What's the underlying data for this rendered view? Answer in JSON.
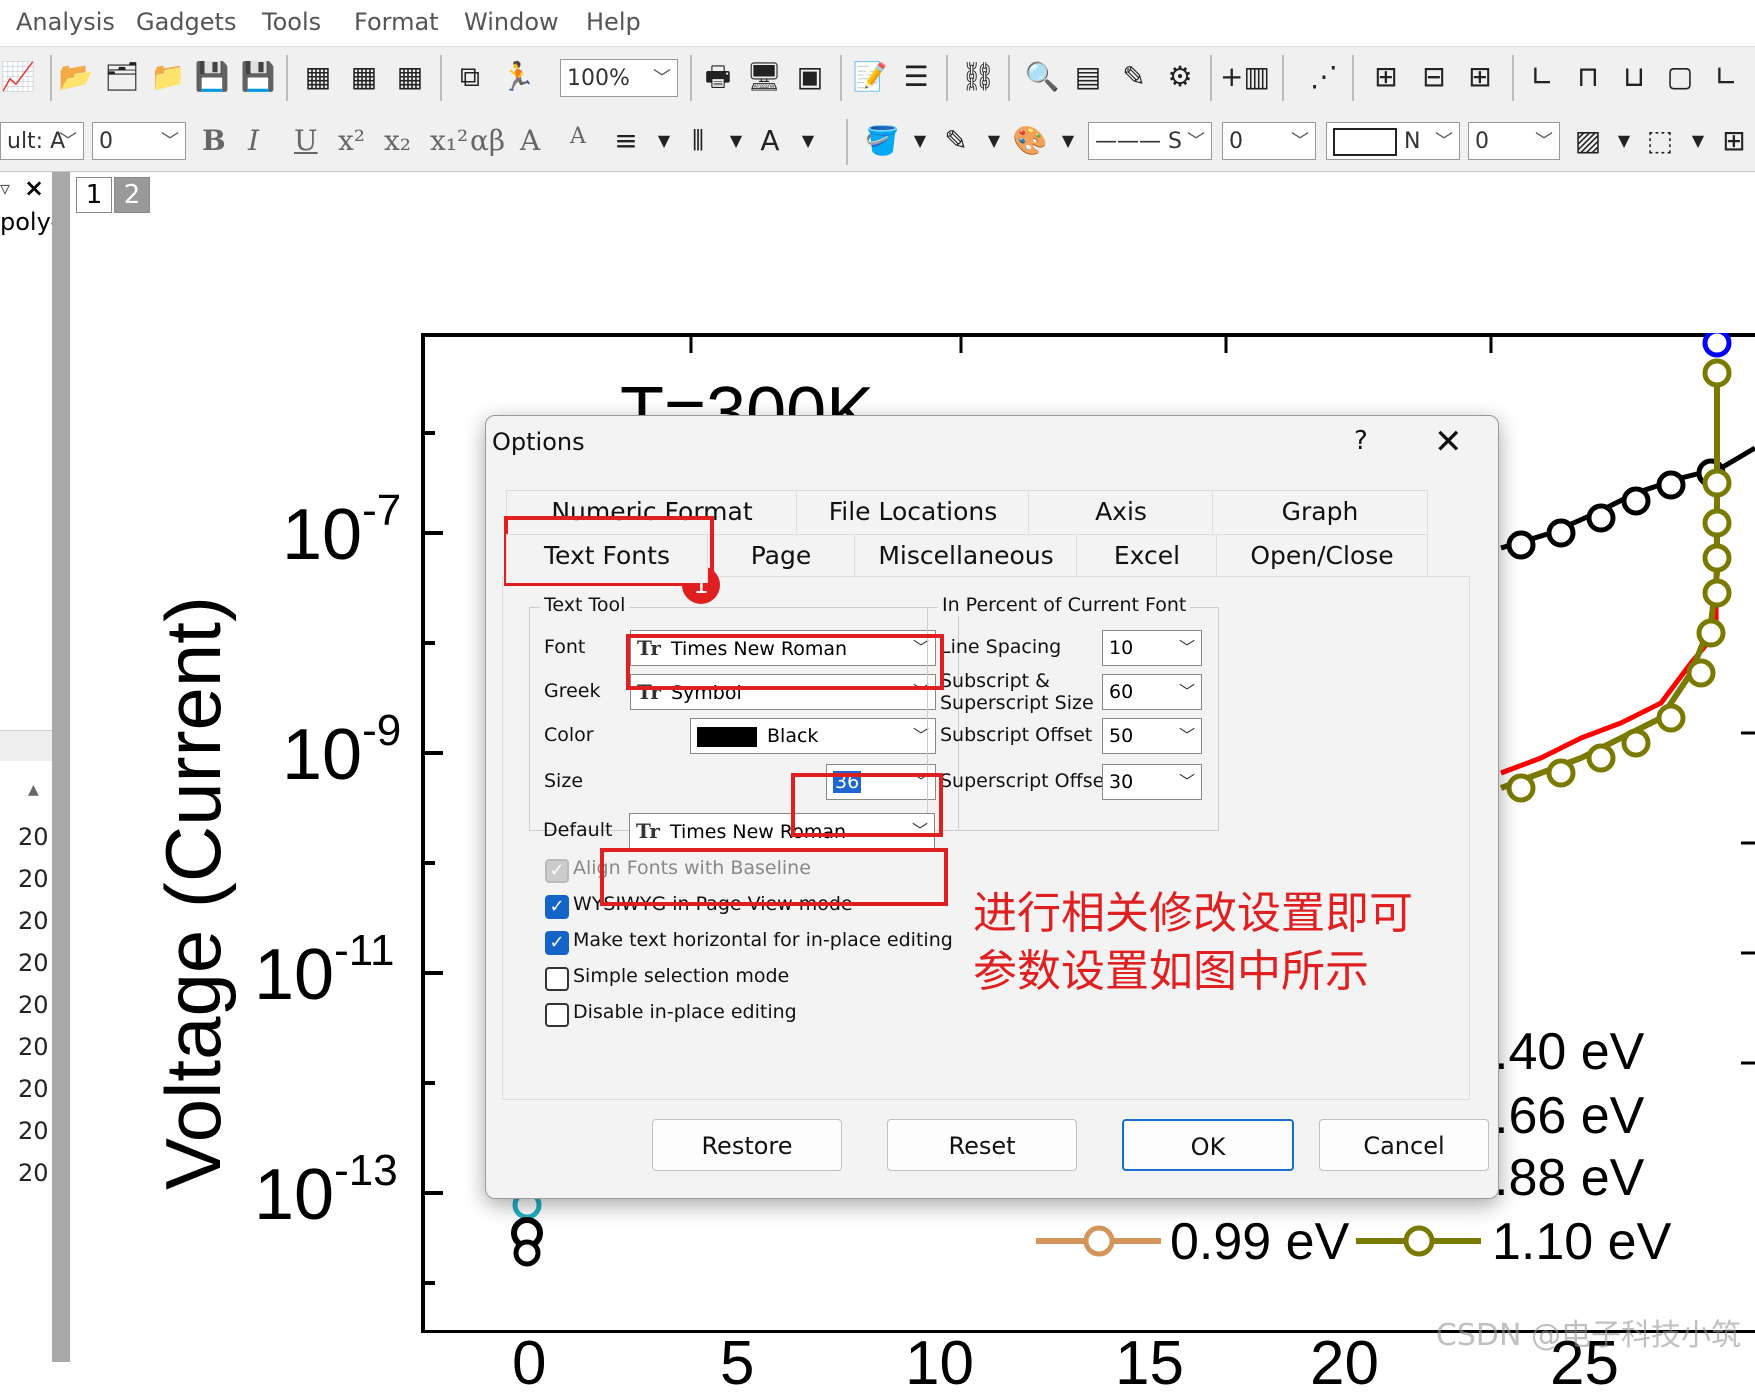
{
  "menu": [
    "Analysis",
    "Gadgets",
    "Tools",
    "Format",
    "Window",
    "Help"
  ],
  "toolbar": {
    "zoom": "100%",
    "font_combo": "ult: A",
    "size_combo": "0",
    "format_buttons": [
      "B",
      "I",
      "U",
      "x²",
      "x₂",
      "x₁²",
      "αβ",
      "A",
      "A"
    ],
    "line_style": "S",
    "line_width": "0",
    "fill_combo": "N",
    "fill_width": "0"
  },
  "left_panel": {
    "close_glyph": "×",
    "item": "poly-",
    "years": [
      "20",
      "20",
      "20",
      "20",
      "20",
      "20",
      "20",
      "20",
      "20"
    ]
  },
  "layers": [
    "1",
    "2"
  ],
  "graph": {
    "y_axis_label": "Voltage (Current)",
    "y_ticks": [
      {
        "base": "10",
        "exp": "-7"
      },
      {
        "base": "10",
        "exp": "-9"
      },
      {
        "base": "10",
        "exp": "-11"
      },
      {
        "base": "10",
        "exp": "-13"
      }
    ],
    "temperature_label": "T=300K",
    "legend": [
      ".40 eV",
      ".66 eV",
      ".88 eV",
      "0.99 eV",
      "1.10 eV"
    ],
    "x_ticks": [
      "0",
      "5",
      "10",
      "15",
      "20",
      "25"
    ],
    "colors": {
      "black": "#000000",
      "red": "#ff0000",
      "olive": "#7a7a00",
      "blue": "#0000ff",
      "tan": "#d4955a",
      "cyan": "#20b0c0"
    }
  },
  "dialog": {
    "title": "Options",
    "help": "?",
    "close": "✕",
    "tabs_row1": [
      "Numeric Format",
      "File Locations",
      "Axis",
      "Graph"
    ],
    "tabs_row2": [
      "Text Fonts",
      "Page",
      "Miscellaneous",
      "Excel",
      "Open/Close"
    ],
    "text_tool": {
      "title": "Text Tool",
      "font_label": "Font",
      "font": "Times New Roman",
      "greek_label": "Greek",
      "greek": "Symbol",
      "color_label": "Color",
      "color": "Black",
      "size_label": "Size",
      "size": "36"
    },
    "percent": {
      "title": "In Percent of Current Font",
      "line_spacing_label": "Line Spacing",
      "line_spacing": "10",
      "sub_sup_size_label1": "Subscript &",
      "sub_sup_size_label2": "Superscript Size",
      "sub_sup_size": "60",
      "subscript_offset_label": "Subscript Offset",
      "subscript_offset": "50",
      "superscript_offset_label": "Superscript Offset",
      "superscript_offset": "30"
    },
    "default_label": "Default",
    "default_font": "Times New Roman",
    "checkboxes": [
      {
        "label": "Align Fonts with Baseline",
        "checked": true,
        "disabled": true
      },
      {
        "label": "WYSIWYG in Page View mode",
        "checked": true,
        "disabled": false
      },
      {
        "label": "Make text horizontal for in-place editing",
        "checked": true,
        "disabled": false
      },
      {
        "label": "Simple selection mode",
        "checked": false,
        "disabled": false
      },
      {
        "label": "Disable in-place editing",
        "checked": false,
        "disabled": false
      }
    ],
    "buttons": {
      "restore": "Restore",
      "reset": "Reset",
      "ok": "OK",
      "cancel": "Cancel"
    },
    "step_marker": "1"
  },
  "annotation": {
    "line1": "进行相关修改设置即可",
    "line2": "参数设置如图中所示",
    "color": "#e02020"
  },
  "watermark": "CSDN @电子科技小筑"
}
